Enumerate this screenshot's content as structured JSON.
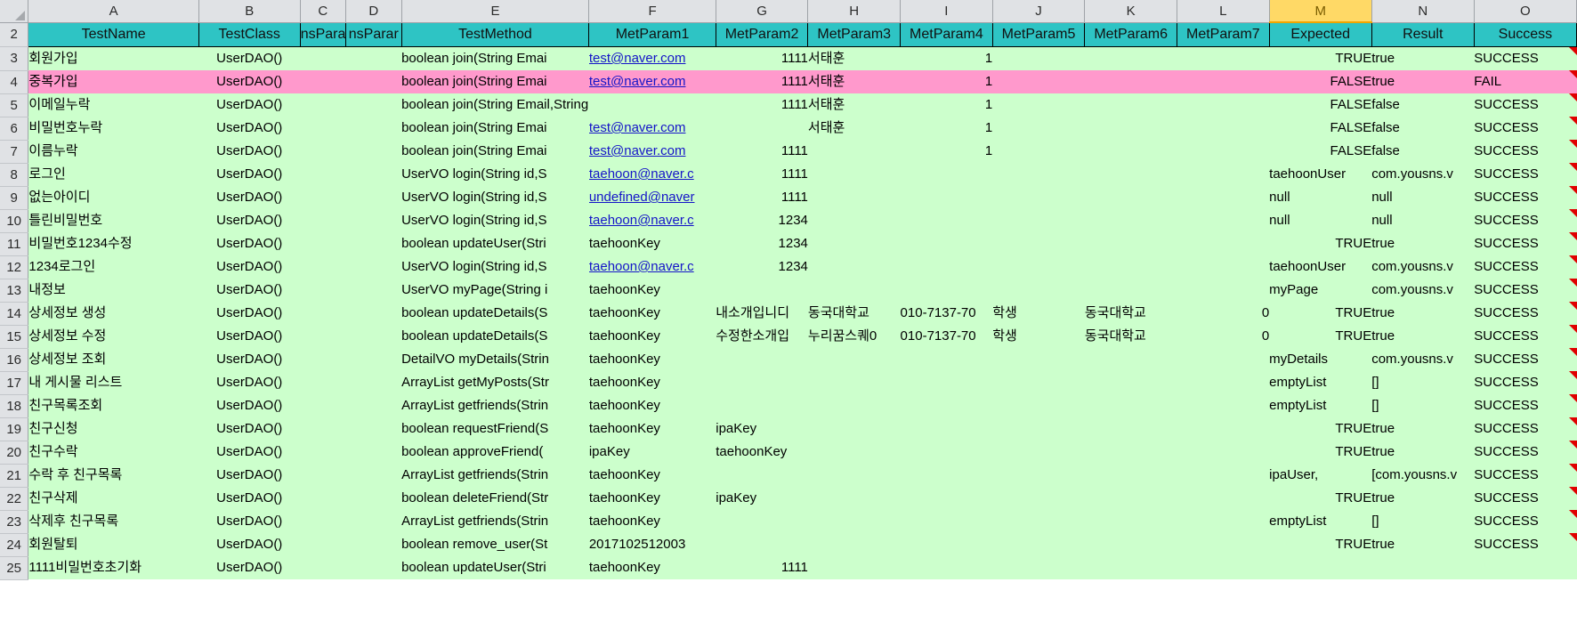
{
  "grid": {
    "column_letters": [
      "A",
      "B",
      "C",
      "D",
      "E",
      "F",
      "G",
      "H",
      "I",
      "J",
      "K",
      "L",
      "M",
      "N",
      "O"
    ],
    "selected_column": "M",
    "row_numbers": [
      "2",
      "3",
      "4",
      "5",
      "6",
      "7",
      "8",
      "9",
      "10",
      "11",
      "12",
      "13",
      "14",
      "15",
      "16",
      "17",
      "18",
      "19",
      "20",
      "21",
      "22",
      "23",
      "24",
      "25"
    ],
    "corner_icon": "select-all-triangle-icon"
  },
  "colors": {
    "header_fill": "#2ec4c4",
    "pass_row_fill": "#ccffcc",
    "fail_row_fill": "#ff99cc",
    "selected_header_fill": "#ffd966",
    "gutter_fill": "#e0e2e5",
    "link_color": "#1414c8",
    "comment_marker": "#e00000"
  },
  "header": {
    "row_number": "2",
    "cells": [
      "TestName",
      "TestClass",
      "nsParar",
      "nsParar",
      "TestMethod",
      "MetParam1",
      "MetParam2",
      "MetParam3",
      "MetParam4",
      "MetParam5",
      "MetParam6",
      "MetParam7",
      "Expected",
      "Result",
      "Success"
    ]
  },
  "rows": [
    {
      "n": "3",
      "status": "pass",
      "a": "회원가입",
      "b": "UserDAO()",
      "c": "",
      "d": "",
      "e": "boolean join(String Emai",
      "f_link": "test@naver.com",
      "f_text": "",
      "g": "1111",
      "h": "서태훈",
      "i": "1",
      "j": "",
      "k": "",
      "l": "",
      "m": "TRUE",
      "nn": "true",
      "o": "SUCCESS",
      "comment": true
    },
    {
      "n": "4",
      "status": "fail",
      "a": "중복가입",
      "b": "UserDAO()",
      "c": "",
      "d": "",
      "e": "boolean join(String Emai",
      "f_link": "test@naver.com",
      "f_text": "",
      "g": "1111",
      "h": "서태훈",
      "i": "1",
      "j": "",
      "k": "",
      "l": "",
      "m": "FALSE",
      "nn": "true",
      "o": "FAIL",
      "comment": true
    },
    {
      "n": "5",
      "status": "pass",
      "a": "이메일누락",
      "b": "UserDAO()",
      "c": "",
      "d": "",
      "e": "boolean join(String Email,String Pwd,String",
      "f_link": "",
      "f_text": "",
      "g": "1111",
      "h": "서태훈",
      "i": "1",
      "j": "",
      "k": "",
      "l": "",
      "m": "FALSE",
      "nn": "false",
      "o": "SUCCESS",
      "comment": true
    },
    {
      "n": "6",
      "status": "pass",
      "a": "비밀번호누락",
      "b": "UserDAO()",
      "c": "",
      "d": "",
      "e": "boolean join(String Emai",
      "f_link": "test@naver.com",
      "f_text": "",
      "g": "",
      "h": "서태훈",
      "i": "1",
      "j": "",
      "k": "",
      "l": "",
      "m": "FALSE",
      "nn": "false",
      "o": "SUCCESS",
      "comment": true
    },
    {
      "n": "7",
      "status": "pass",
      "a": "이름누락",
      "b": "UserDAO()",
      "c": "",
      "d": "",
      "e": "boolean join(String Emai",
      "f_link": "test@naver.com",
      "f_text": "",
      "g": "1111",
      "h": "",
      "i": "1",
      "j": "",
      "k": "",
      "l": "",
      "m": "FALSE",
      "nn": "false",
      "o": "SUCCESS",
      "comment": true
    },
    {
      "n": "8",
      "status": "pass",
      "a": "로그인",
      "b": "UserDAO()",
      "c": "",
      "d": "",
      "e": "UserVO login(String id,S",
      "f_link": "taehoon@naver.c",
      "f_text": "",
      "g": "1111",
      "h": "",
      "i": "",
      "j": "",
      "k": "",
      "l": "",
      "m": "taehoonUser",
      "nn": "com.yousns.v",
      "o": "SUCCESS",
      "comment": true
    },
    {
      "n": "9",
      "status": "pass",
      "a": "없는아이디",
      "b": "UserDAO()",
      "c": "",
      "d": "",
      "e": "UserVO login(String id,S",
      "f_link": "undefined@naver",
      "f_text": "",
      "g": "1111",
      "h": "",
      "i": "",
      "j": "",
      "k": "",
      "l": "",
      "m": "null",
      "nn": "null",
      "o": "SUCCESS",
      "comment": true
    },
    {
      "n": "10",
      "status": "pass",
      "a": "틀린비밀번호",
      "b": "UserDAO()",
      "c": "",
      "d": "",
      "e": "UserVO login(String id,S",
      "f_link": "taehoon@naver.c",
      "f_text": "",
      "g": "1234",
      "h": "",
      "i": "",
      "j": "",
      "k": "",
      "l": "",
      "m": "null",
      "nn": "null",
      "o": "SUCCESS",
      "comment": true
    },
    {
      "n": "11",
      "status": "pass",
      "a": "비밀번호1234수정",
      "b": "UserDAO()",
      "c": "",
      "d": "",
      "e": "boolean updateUser(Stri",
      "f_link": "",
      "f_text": "taehoonKey",
      "g": "1234",
      "h": "",
      "i": "",
      "j": "",
      "k": "",
      "l": "",
      "m": "TRUE",
      "nn": "true",
      "o": "SUCCESS",
      "comment": true
    },
    {
      "n": "12",
      "status": "pass",
      "a": "1234로그인",
      "b": "UserDAO()",
      "c": "",
      "d": "",
      "e": "UserVO login(String id,S",
      "f_link": "taehoon@naver.c",
      "f_text": "",
      "g": "1234",
      "h": "",
      "i": "",
      "j": "",
      "k": "",
      "l": "",
      "m": "taehoonUser",
      "nn": "com.yousns.v",
      "o": "SUCCESS",
      "comment": true
    },
    {
      "n": "13",
      "status": "pass",
      "a": "내정보",
      "b": "UserDAO()",
      "c": "",
      "d": "",
      "e": "UserVO myPage(String i",
      "f_link": "",
      "f_text": "taehoonKey",
      "g": "",
      "h": "",
      "i": "",
      "j": "",
      "k": "",
      "l": "",
      "m": "myPage",
      "nn": "com.yousns.v",
      "o": "SUCCESS",
      "comment": true
    },
    {
      "n": "14",
      "status": "pass",
      "a": "상세정보 생성",
      "b": "UserDAO()",
      "c": "",
      "d": "",
      "e": "boolean updateDetails(S",
      "f_link": "",
      "f_text": "taehoonKey",
      "g": "내소개입니디",
      "h": "동국대학교",
      "i": "010-7137-70",
      "j": "학생",
      "k": "동국대학교",
      "l": "0",
      "m": "TRUE",
      "nn": "true",
      "o": "SUCCESS",
      "comment": true
    },
    {
      "n": "15",
      "status": "pass",
      "a": "상세정보 수정",
      "b": "UserDAO()",
      "c": "",
      "d": "",
      "e": "boolean updateDetails(S",
      "f_link": "",
      "f_text": "taehoonKey",
      "g": "수정한소개입",
      "h": "누리꿈스퀘0",
      "i": "010-7137-70",
      "j": "학생",
      "k": "동국대학교",
      "l": "0",
      "m": "TRUE",
      "nn": "true",
      "o": "SUCCESS",
      "comment": true
    },
    {
      "n": "16",
      "status": "pass",
      "a": "상세정보 조회",
      "b": "UserDAO()",
      "c": "",
      "d": "",
      "e": "DetailVO myDetails(Strin",
      "f_link": "",
      "f_text": "taehoonKey",
      "g": "",
      "h": "",
      "i": "",
      "j": "",
      "k": "",
      "l": "",
      "m": "myDetails",
      "nn": "com.yousns.v",
      "o": "SUCCESS",
      "comment": true
    },
    {
      "n": "17",
      "status": "pass",
      "a": "내 게시물 리스트",
      "b": "UserDAO()",
      "c": "",
      "d": "",
      "e": "ArrayList getMyPosts(Str",
      "f_link": "",
      "f_text": "taehoonKey",
      "g": "",
      "h": "",
      "i": "",
      "j": "",
      "k": "",
      "l": "",
      "m": "emptyList",
      "nn": "[]",
      "o": "SUCCESS",
      "comment": true
    },
    {
      "n": "18",
      "status": "pass",
      "a": "친구목록조회",
      "b": "UserDAO()",
      "c": "",
      "d": "",
      "e": "ArrayList getfriends(Strin",
      "f_link": "",
      "f_text": "taehoonKey",
      "g": "",
      "h": "",
      "i": "",
      "j": "",
      "k": "",
      "l": "",
      "m": "emptyList",
      "nn": "[]",
      "o": "SUCCESS",
      "comment": true
    },
    {
      "n": "19",
      "status": "pass",
      "a": "친구신청",
      "b": "UserDAO()",
      "c": "",
      "d": "",
      "e": "boolean requestFriend(S",
      "f_link": "",
      "f_text": "taehoonKey",
      "g": "ipaKey",
      "h": "",
      "i": "",
      "j": "",
      "k": "",
      "l": "",
      "m": "TRUE",
      "nn": "true",
      "o": "SUCCESS",
      "comment": true
    },
    {
      "n": "20",
      "status": "pass",
      "a": "친구수락",
      "b": "UserDAO()",
      "c": "",
      "d": "",
      "e": "boolean approveFriend(",
      "f_link": "",
      "f_text": "ipaKey",
      "g": "taehoonKey",
      "h": "",
      "i": "",
      "j": "",
      "k": "",
      "l": "",
      "m": "TRUE",
      "nn": "true",
      "o": "SUCCESS",
      "comment": true
    },
    {
      "n": "21",
      "status": "pass",
      "a": "수락 후 친구목록",
      "b": "UserDAO()",
      "c": "",
      "d": "",
      "e": "ArrayList getfriends(Strin",
      "f_link": "",
      "f_text": "taehoonKey",
      "g": "",
      "h": "",
      "i": "",
      "j": "",
      "k": "",
      "l": "",
      "m": "ipaUser,",
      "nn": "[com.yousns.v",
      "o": "SUCCESS",
      "comment": true
    },
    {
      "n": "22",
      "status": "pass",
      "a": "친구삭제",
      "b": "UserDAO()",
      "c": "",
      "d": "",
      "e": "boolean deleteFriend(Str",
      "f_link": "",
      "f_text": "taehoonKey",
      "g": "ipaKey",
      "h": "",
      "i": "",
      "j": "",
      "k": "",
      "l": "",
      "m": "TRUE",
      "nn": "true",
      "o": "SUCCESS",
      "comment": true
    },
    {
      "n": "23",
      "status": "pass",
      "a": "삭제후 친구목록",
      "b": "UserDAO()",
      "c": "",
      "d": "",
      "e": "ArrayList getfriends(Strin",
      "f_link": "",
      "f_text": "taehoonKey",
      "g": "",
      "h": "",
      "i": "",
      "j": "",
      "k": "",
      "l": "",
      "m": "emptyList",
      "nn": "[]",
      "o": "SUCCESS",
      "comment": true
    },
    {
      "n": "24",
      "status": "pass",
      "a": "회원탈퇴",
      "b": "UserDAO()",
      "c": "",
      "d": "",
      "e": "boolean remove_user(St",
      "f_link": "",
      "f_text": "2017102512003",
      "g": "",
      "h": "",
      "i": "",
      "j": "",
      "k": "",
      "l": "",
      "m": "TRUE",
      "nn": "true",
      "o": "SUCCESS",
      "comment": true
    },
    {
      "n": "25",
      "status": "pass",
      "a": "1111비밀번호초기화",
      "b": "UserDAO()",
      "c": "",
      "d": "",
      "e": "boolean updateUser(Stri",
      "f_link": "",
      "f_text": "taehoonKey",
      "g": "1111",
      "h": "",
      "i": "",
      "j": "",
      "k": "",
      "l": "",
      "m": "",
      "nn": "",
      "o": "",
      "comment": false
    }
  ]
}
